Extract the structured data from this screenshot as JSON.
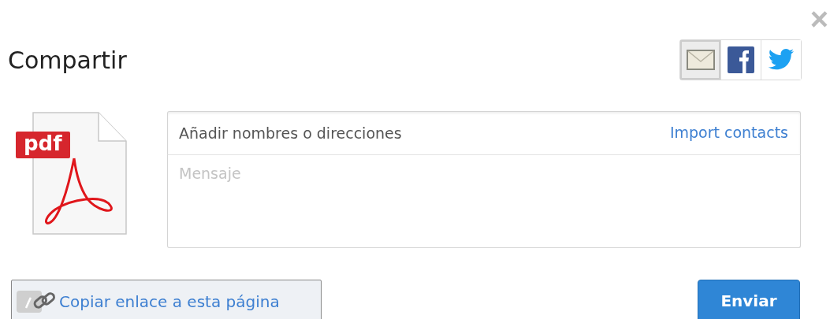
{
  "dialog": {
    "title": "Compartir",
    "close": "×"
  },
  "share_options": [
    {
      "kind": "email",
      "selected": true
    },
    {
      "kind": "facebook",
      "selected": false
    },
    {
      "kind": "twitter",
      "selected": false
    }
  ],
  "file_icon": {
    "label": "pdf"
  },
  "recipients": {
    "placeholder": "Añadir nombres o direcciones"
  },
  "import_link": "Import contacts",
  "message": {
    "placeholder": "Mensaje"
  },
  "copy_link_button": "Copiar enlace a esta página",
  "send_button": "Enviar"
}
